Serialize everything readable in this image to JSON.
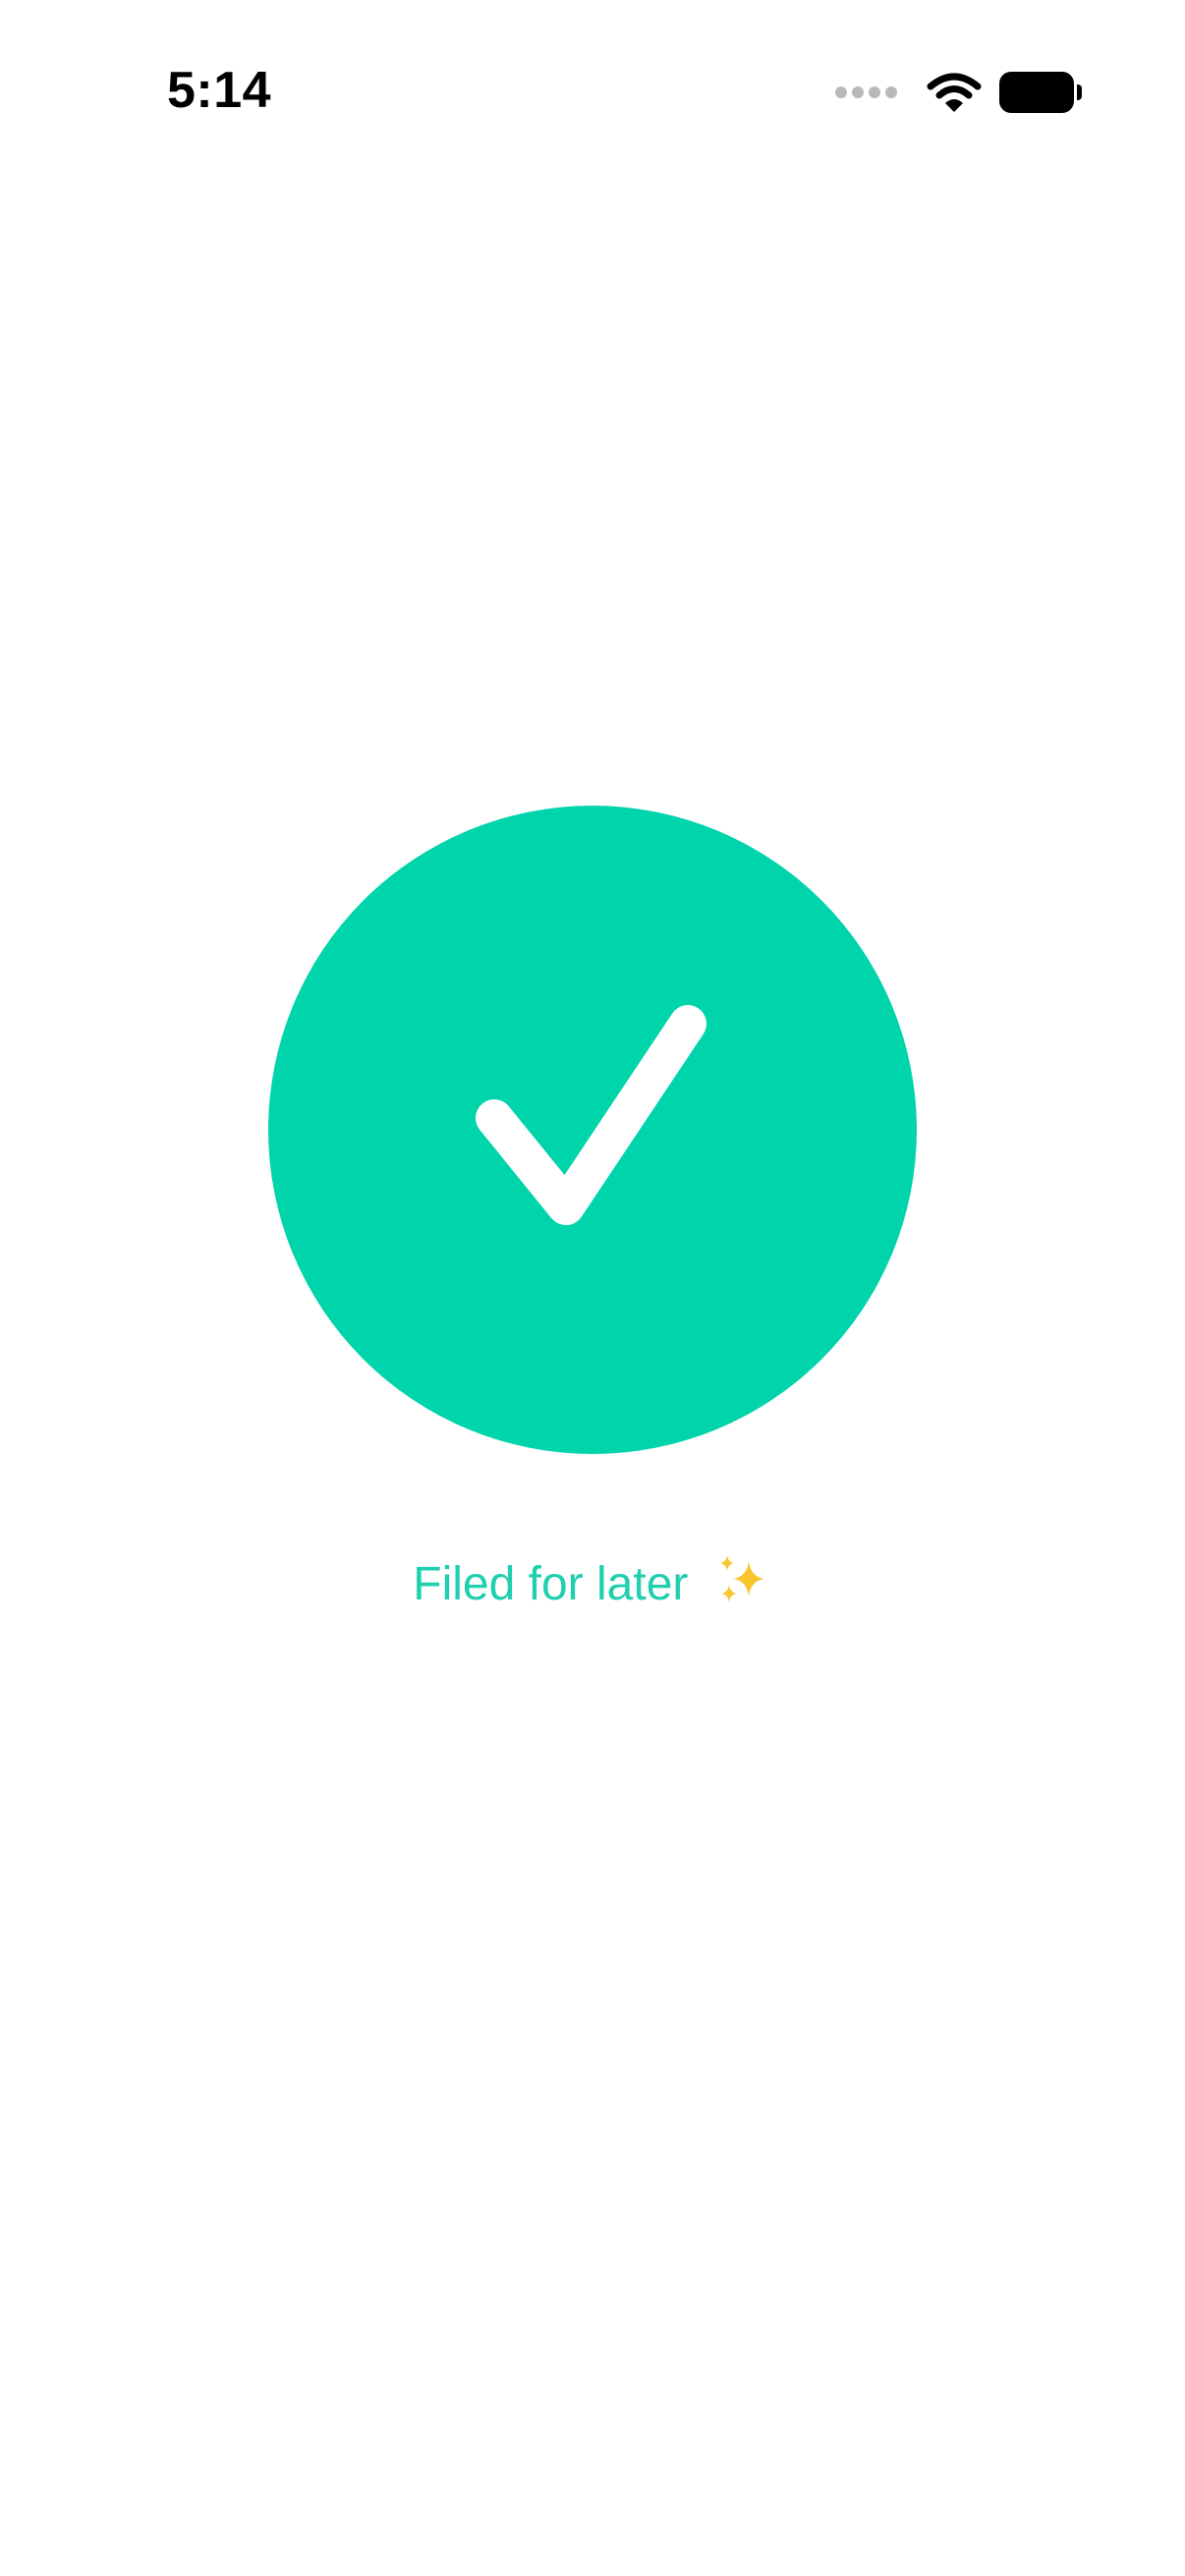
{
  "status_bar": {
    "time": "5:14",
    "signal_icon": "signal-dots-icon",
    "wifi_icon": "wifi-icon",
    "battery_icon": "battery-icon"
  },
  "confirmation": {
    "icon": "checkmark-icon",
    "message": "Filed for later",
    "emoji_icon": "sparkles-icon"
  },
  "colors": {
    "accent": "#00d4ab",
    "message_text": "#1fcfae",
    "sparkle": "#f9c52e"
  }
}
